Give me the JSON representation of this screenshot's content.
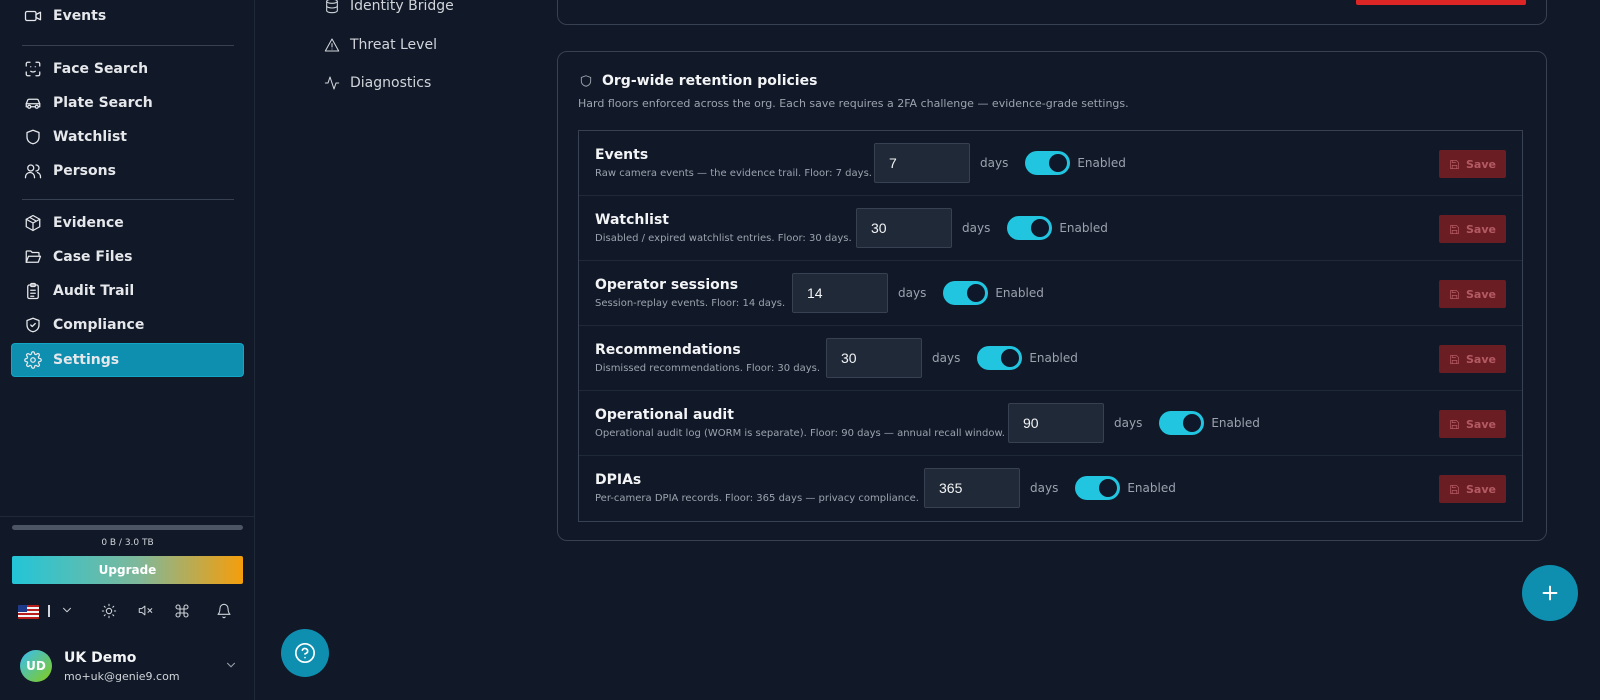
{
  "sidebar": {
    "nav": {
      "events": "Events",
      "face_search": "Face Search",
      "plate_search": "Plate Search",
      "watchlist": "Watchlist",
      "persons": "Persons",
      "evidence": "Evidence",
      "case_files": "Case Files",
      "audit_trail": "Audit Trail",
      "compliance": "Compliance",
      "settings": "Settings"
    },
    "active_item": "Settings",
    "storage_label": "0 B / 3.0 TB",
    "storage_used_fraction": 0,
    "upgrade_label": "Upgrade",
    "user": {
      "initials": "UD",
      "name": "UK Demo",
      "email": "mo+uk@genie9.com"
    }
  },
  "settings_nav": {
    "identity_bridge": "Identity Bridge",
    "threat_level": "Threat Level",
    "diagnostics": "Diagnostics"
  },
  "retention": {
    "title": "Org-wide retention policies",
    "description": "Hard floors enforced across the org. Each save requires a 2FA challenge — evidence-grade settings.",
    "days_label": "days",
    "enabled_label": "Enabled",
    "save_label": "Save",
    "rows": [
      {
        "name": "Events",
        "description": "Raw camera events — the evidence trail. Floor: 7 days.",
        "value": "7",
        "enabled": true
      },
      {
        "name": "Watchlist",
        "description": "Disabled / expired watchlist entries. Floor: 30 days.",
        "value": "30",
        "enabled": true
      },
      {
        "name": "Operator sessions",
        "description": "Session-replay events. Floor: 14 days.",
        "value": "14",
        "enabled": true
      },
      {
        "name": "Recommendations",
        "description": "Dismissed recommendations. Floor: 30 days.",
        "value": "30",
        "enabled": true
      },
      {
        "name": "Operational audit",
        "description": "Operational audit log (WORM is separate). Floor: 90 days — annual recall window.",
        "value": "90",
        "enabled": true
      },
      {
        "name": "DPIAs",
        "description": "Per-camera DPIA records. Floor: 365 days — privacy compliance.",
        "value": "365",
        "enabled": true
      }
    ]
  },
  "colors": {
    "accent": "#0e8fb0",
    "toggle_on": "#22c5e0",
    "danger": "#dc2626",
    "background": "#111827"
  }
}
